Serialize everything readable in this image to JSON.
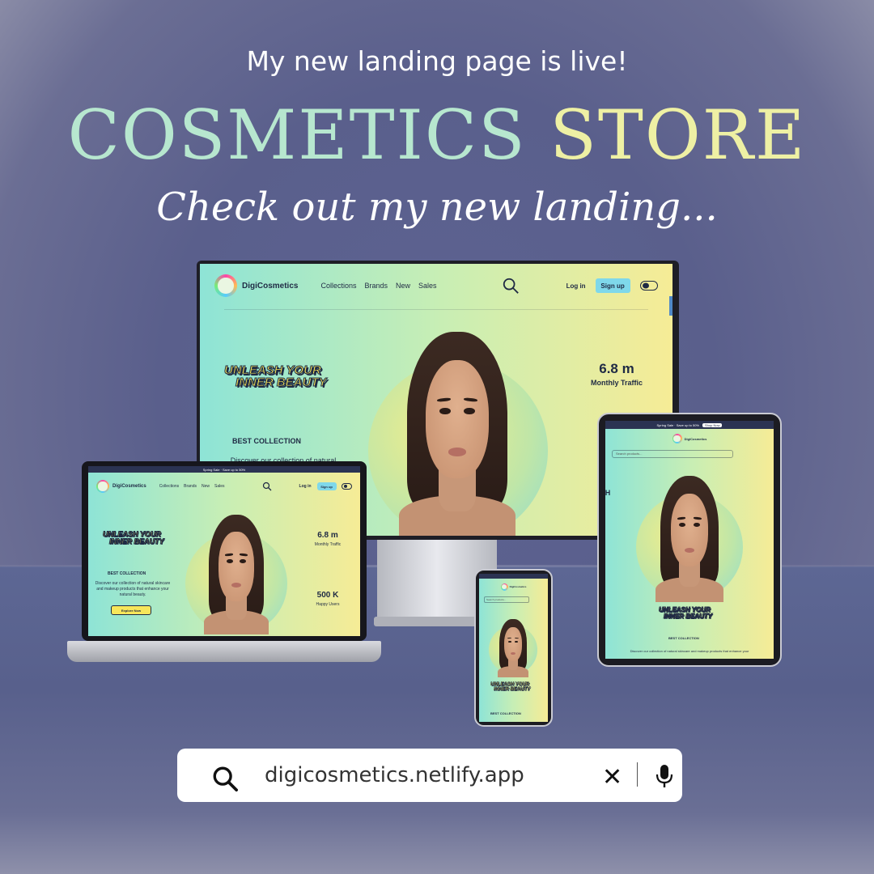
{
  "headline": "My new landing page is live!",
  "title": {
    "word1": "COSMETICS",
    "word2": "STORE"
  },
  "tagline": "Check out my new landing...",
  "site": {
    "brand": "DigiCosmetics",
    "nav": [
      "Collections",
      "Brands",
      "New",
      "Sales"
    ],
    "login": "Log in",
    "signup": "Sign up",
    "hero": {
      "line1": "UNLEASH YOUR",
      "line2": "INNER BEAUTY"
    },
    "stats": [
      {
        "value": "6.8 m",
        "label": "Monthly Traffic"
      },
      {
        "value": "500 K",
        "label": "Happy Users"
      }
    ],
    "best_collection": "BEST COLLECTION",
    "description": "Discover our collection of natural skincare and makeup products that enhance your natural beauty.",
    "desktop_desc": "Discover our collection of natural",
    "tablet_desc": "Discover our collection of natural skincare and makeup products that enhance your",
    "explore": "Explore Now",
    "search_placeholder": "Search products...",
    "promo": "Spring Sale · Save up to 50%",
    "shop_now": "Shop Now",
    "tablet_partial": "H"
  },
  "url_bar": {
    "url": "digicosmetics.netlify.app"
  },
  "colors": {
    "mint": "#b7e7cf",
    "butter": "#eef0a4",
    "accent_blue": "#7fd8ea",
    "navy": "#1f2a44"
  }
}
